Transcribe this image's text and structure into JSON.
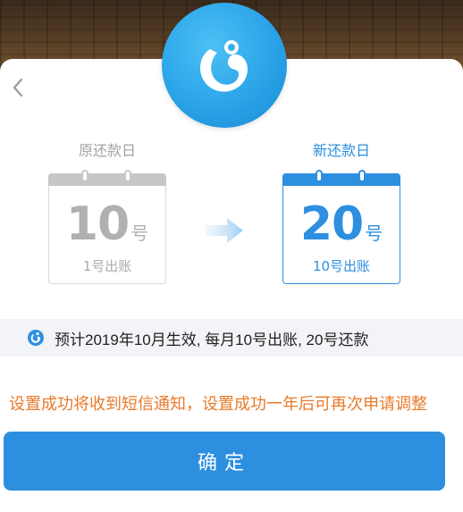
{
  "header": {
    "logo_icon": "app-logo-icon",
    "back_icon": "chevron-left-icon"
  },
  "old_day": {
    "title": "原还款日",
    "day": "10",
    "unit": "号",
    "billing": "1号出账"
  },
  "new_day": {
    "title": "新还款日",
    "day": "20",
    "unit": "号",
    "billing": "10号出账"
  },
  "info": {
    "icon": "app-logo-small-icon",
    "text": "预计2019年10月生效, 每月10号出账, 20号还款"
  },
  "notice": "设置成功将收到短信通知，设置成功一年后可再次申请调整",
  "confirm_label": "确定",
  "colors": {
    "brand_blue": "#2d8fe0",
    "notice_orange": "#e87a2a",
    "muted_gray": "#a3a3a3"
  }
}
